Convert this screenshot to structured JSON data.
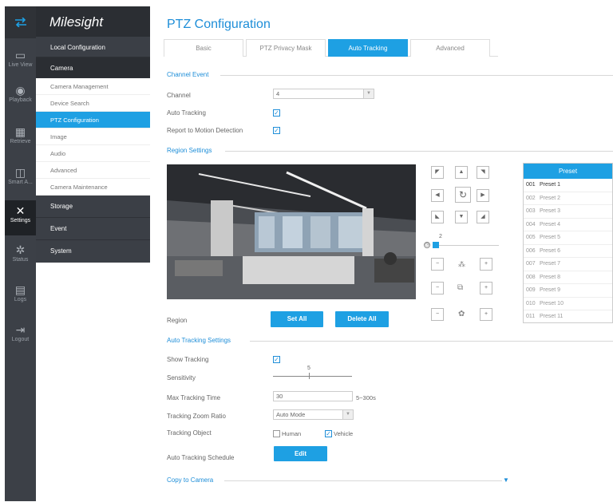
{
  "brand": "Milesight",
  "sidebar_icons": [
    {
      "label": "Live View",
      "icon": "live-view-icon"
    },
    {
      "label": "Playback",
      "icon": "playback-icon"
    },
    {
      "label": "Retrieve",
      "icon": "retrieve-icon"
    },
    {
      "label": "Smart A...",
      "icon": "smart-analytics-icon"
    },
    {
      "label": "Settings",
      "icon": "settings-icon"
    },
    {
      "label": "Status",
      "icon": "status-icon"
    },
    {
      "label": "Logs",
      "icon": "logs-icon"
    },
    {
      "label": "Logout",
      "icon": "logout-icon"
    }
  ],
  "menu": {
    "local_configuration": "Local Configuration",
    "camera": "Camera",
    "camera_items": [
      "Camera Management",
      "Device Search",
      "PTZ Configuration",
      "Image",
      "Audio",
      "Advanced",
      "Camera Maintenance"
    ],
    "storage": "Storage",
    "event": "Event",
    "system": "System"
  },
  "page_title": "PTZ Configuration",
  "tabs": [
    "Basic",
    "PTZ Privacy Mask",
    "Auto Tracking",
    "Advanced"
  ],
  "channel_event": {
    "section": "Channel Event",
    "channel_label": "Channel",
    "channel_value": "4",
    "auto_tracking_label": "Auto Tracking",
    "report_label": "Report to Motion Detection"
  },
  "region_settings": {
    "section": "Region Settings",
    "region_label": "Region",
    "set_all": "Set All",
    "delete_all": "Delete All",
    "speed_value": "2"
  },
  "preset": {
    "header": "Preset",
    "rows": [
      {
        "num": "001",
        "name": "Preset 1"
      },
      {
        "num": "002",
        "name": "Preset 2"
      },
      {
        "num": "003",
        "name": "Preset 3"
      },
      {
        "num": "004",
        "name": "Preset 4"
      },
      {
        "num": "005",
        "name": "Preset 5"
      },
      {
        "num": "006",
        "name": "Preset 6"
      },
      {
        "num": "007",
        "name": "Preset 7"
      },
      {
        "num": "008",
        "name": "Preset 8"
      },
      {
        "num": "009",
        "name": "Preset 9"
      },
      {
        "num": "010",
        "name": "Preset 10"
      },
      {
        "num": "011",
        "name": "Preset 11"
      }
    ]
  },
  "auto_tracking_settings": {
    "section": "Auto Tracking Settings",
    "show_tracking": "Show Tracking",
    "sensitivity": "Sensitivity",
    "sensitivity_value": "5",
    "max_time_label": "Max Tracking Time",
    "max_time_value": "30",
    "max_time_range": "5~300s",
    "zoom_ratio_label": "Tracking Zoom Ratio",
    "zoom_ratio_value": "Auto Mode",
    "object_label": "Tracking Object",
    "human": "Human",
    "vehicle": "Vehicle",
    "schedule_label": "Auto Tracking Schedule",
    "edit": "Edit"
  },
  "copy_to_camera": "Copy to Camera",
  "colors": {
    "accent": "#1ea0e3",
    "sidebar_dark": "#2b2e33",
    "sidebar": "#3b3f46"
  }
}
